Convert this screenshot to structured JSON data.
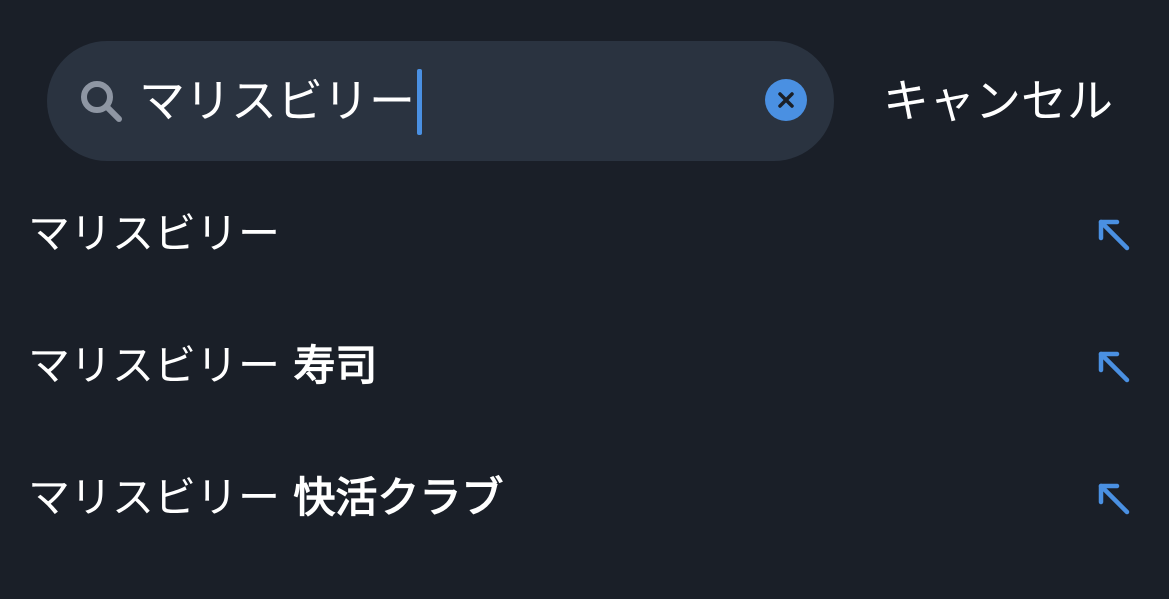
{
  "search": {
    "query": "マリスビリー",
    "clear_label": "×",
    "cancel_label": "キャンセル"
  },
  "suggestions": [
    {
      "prefix": "マリスビリー",
      "suffix": ""
    },
    {
      "prefix": "マリスビリー ",
      "suffix": "寿司"
    },
    {
      "prefix": "マリスビリー ",
      "suffix": "快活クラブ"
    }
  ],
  "colors": {
    "background": "#1a1f28",
    "search_field": "#2a3340",
    "accent": "#4a90e2",
    "text": "#ffffff",
    "icon_gray": "#8e96a3"
  },
  "icons": {
    "search": "search-icon",
    "clear": "clear-icon",
    "fill": "arrow-up-left-icon"
  }
}
